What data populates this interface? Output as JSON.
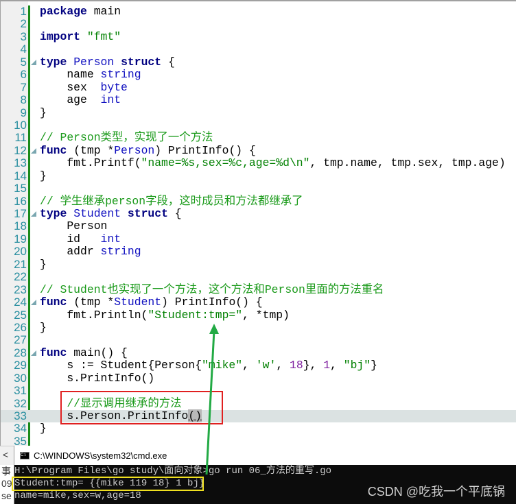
{
  "code_lines": [
    [
      [
        "k",
        "package"
      ],
      [
        "p",
        " main"
      ]
    ],
    [],
    [
      [
        "k",
        "import"
      ],
      [
        "p",
        " "
      ],
      [
        "s",
        "\"fmt\""
      ]
    ],
    [],
    [
      [
        "k",
        "type"
      ],
      [
        "p",
        " "
      ],
      [
        "t",
        "Person"
      ],
      [
        "p",
        " "
      ],
      [
        "k",
        "struct"
      ],
      [
        "p",
        " {"
      ]
    ],
    [
      [
        "p",
        "    name "
      ],
      [
        "t",
        "string"
      ]
    ],
    [
      [
        "p",
        "    sex  "
      ],
      [
        "t",
        "byte"
      ]
    ],
    [
      [
        "p",
        "    age  "
      ],
      [
        "t",
        "int"
      ]
    ],
    [
      [
        "p",
        "}"
      ]
    ],
    [],
    [
      [
        "c",
        "// Person类型，实现了一个方法"
      ]
    ],
    [
      [
        "k",
        "func"
      ],
      [
        "p",
        " (tmp *"
      ],
      [
        "t",
        "Person"
      ],
      [
        "p",
        ") PrintInfo() {"
      ]
    ],
    [
      [
        "p",
        "    fmt.Printf("
      ],
      [
        "s",
        "\"name=%s,sex=%c,age=%d\\n\""
      ],
      [
        "p",
        ", tmp.name, tmp.sex, tmp.age)"
      ]
    ],
    [
      [
        "p",
        "}"
      ]
    ],
    [],
    [
      [
        "c",
        "// 学生继承person字段，这时成员和方法都继承了"
      ]
    ],
    [
      [
        "k",
        "type"
      ],
      [
        "p",
        " "
      ],
      [
        "t",
        "Student"
      ],
      [
        "p",
        " "
      ],
      [
        "k",
        "struct"
      ],
      [
        "p",
        " {"
      ]
    ],
    [
      [
        "p",
        "    Person"
      ]
    ],
    [
      [
        "p",
        "    id   "
      ],
      [
        "t",
        "int"
      ]
    ],
    [
      [
        "p",
        "    addr "
      ],
      [
        "t",
        "string"
      ]
    ],
    [
      [
        "p",
        "}"
      ]
    ],
    [],
    [
      [
        "c",
        "// Student也实现了一个方法，这个方法和Person里面的方法重名"
      ]
    ],
    [
      [
        "k",
        "func"
      ],
      [
        "p",
        " (tmp *"
      ],
      [
        "t",
        "Student"
      ],
      [
        "p",
        ") PrintInfo() {"
      ]
    ],
    [
      [
        "p",
        "    fmt.Println("
      ],
      [
        "s",
        "\"Student:tmp=\""
      ],
      [
        "p",
        ", *tmp)"
      ]
    ],
    [
      [
        "p",
        "}"
      ]
    ],
    [],
    [
      [
        "k",
        "func"
      ],
      [
        "p",
        " main() {"
      ]
    ],
    [
      [
        "p",
        "    s := Student{Person{"
      ],
      [
        "s",
        "\"mike\""
      ],
      [
        "p",
        ", "
      ],
      [
        "s",
        "'w'"
      ],
      [
        "p",
        ", "
      ],
      [
        "n",
        "18"
      ],
      [
        "p",
        "}, "
      ],
      [
        "n",
        "1"
      ],
      [
        "p",
        ", "
      ],
      [
        "s",
        "\"bj\""
      ],
      [
        "p",
        "}"
      ]
    ],
    [
      [
        "p",
        "    s.PrintInfo()"
      ]
    ],
    [],
    [
      [
        "c",
        "    //显示调用继承的方法"
      ]
    ],
    [
      [
        "p",
        "    s.Person.PrintInfo"
      ],
      [
        "h",
        "()"
      ]
    ],
    [
      [
        "p",
        "}"
      ]
    ],
    []
  ],
  "fold_lines": [
    5,
    12,
    17,
    24,
    28
  ],
  "current_line": 33,
  "cmd": {
    "title": "C:\\WINDOWS\\system32\\cmd.exe",
    "icon": "console-icon",
    "lines": [
      "H:\\Program Files\\go study\\面向对象>go run 06_方法的重写.go",
      "Student:tmp= {{mike 119 18} 1 bj}",
      "name=mike,sex=w,age=18"
    ]
  },
  "left_pane": [
    "事",
    "09",
    "se"
  ],
  "scroll_arrow": "<",
  "watermark": "CSDN @吃我一个平底锅",
  "colors": {
    "keyword": "#000080",
    "type": "#1010c0",
    "string": "#008000",
    "comment": "#1a9a1a",
    "number": "#8020a0",
    "annotation_red": "#e02020",
    "annotation_yellow": "#f0e020",
    "arrow_green": "#22aa44"
  }
}
